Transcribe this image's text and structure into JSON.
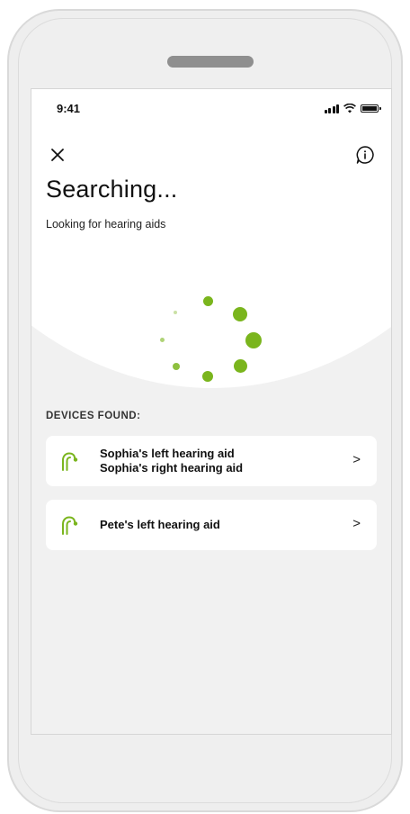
{
  "status_bar": {
    "time": "9:41"
  },
  "header": {
    "close_icon": "close-icon",
    "info_icon": "info-icon",
    "title": "Searching...",
    "subtitle": "Looking for hearing aids"
  },
  "spinner": {
    "color": "#7ab51d",
    "icon": "loading-spinner"
  },
  "devices": {
    "section_label": "DEVICES FOUND:",
    "items": [
      {
        "names": [
          "Sophia's left hearing aid",
          "Sophia's right hearing aid"
        ],
        "icon": "hearing-aid-icon",
        "chevron": ">"
      },
      {
        "names": [
          "Pete's left hearing aid"
        ],
        "icon": "hearing-aid-icon",
        "chevron": ">"
      }
    ]
  },
  "colors": {
    "accent": "#7ab51d",
    "background": "#f1f1f1",
    "card": "#ffffff"
  }
}
